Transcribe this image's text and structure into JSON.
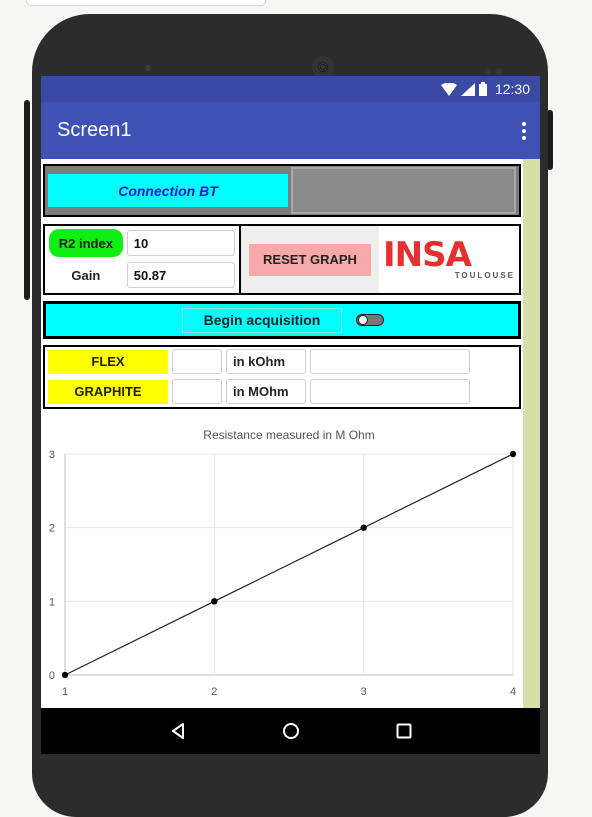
{
  "status_bar": {
    "time": "12:30",
    "icons": [
      "wifi-icon",
      "signal-icon",
      "battery-icon"
    ]
  },
  "app_bar": {
    "title": "Screen1",
    "menu_icon": "overflow-menu-icon"
  },
  "connection": {
    "button_label": "Connection BT",
    "status_text": ""
  },
  "parameters": {
    "r2_label": "R2 index",
    "r2_value": "10",
    "gain_label": "Gain",
    "gain_value": "50.87"
  },
  "reset": {
    "label": "RESET GRAPH"
  },
  "logo": {
    "main": "INSA",
    "sub": "TOULOUSE"
  },
  "acquisition": {
    "label": "Begin acquisition",
    "toggle_on": false
  },
  "measurements": [
    {
      "label": "FLEX",
      "value": "",
      "unit": "in kOhm",
      "extra": ""
    },
    {
      "label": "GRAPHITE",
      "value": "",
      "unit": "in MOhm",
      "extra": ""
    }
  ],
  "colors": {
    "app_bar": "#3f51b5",
    "status_bar": "#3a4aa3",
    "cyan": "#00ffff",
    "r2_green": "#11ee11",
    "reset_pink": "#f7a8a8",
    "yellow": "#ffff00",
    "insa_red": "#e4312f"
  },
  "chart_data": {
    "type": "line",
    "title": "Resistance measured in M Ohm",
    "x": [
      1,
      2,
      3,
      4
    ],
    "y": [
      0,
      1,
      2,
      3
    ],
    "xticks": [
      "1",
      "2",
      "3",
      "4"
    ],
    "yticks": [
      "0",
      "1",
      "2",
      "3"
    ],
    "xlim": [
      1,
      4
    ],
    "ylim": [
      0,
      3
    ],
    "grid": true,
    "legend": "none"
  },
  "nav": {
    "back": "back-icon",
    "home": "home-icon",
    "recents": "recents-icon"
  }
}
